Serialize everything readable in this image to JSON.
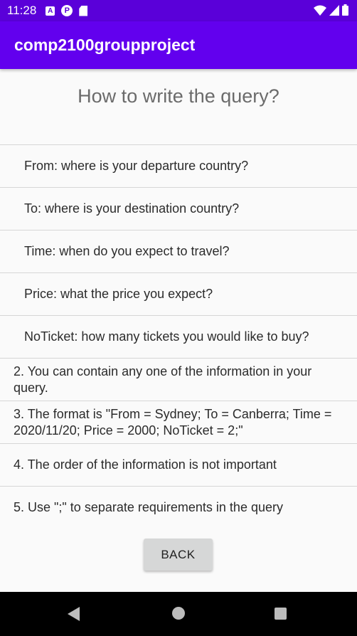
{
  "status_bar": {
    "time": "11:28",
    "icons": [
      "a-notification-icon",
      "p-notification-icon",
      "sd-card-icon",
      "wifi-icon",
      "cell-signal-icon",
      "battery-icon"
    ]
  },
  "app_bar": {
    "title": "comp2100groupproject"
  },
  "heading": "How to write the query?",
  "rows": [
    "From: where is your departure country?",
    "To: where is your destination country?",
    "Time: when do you expect to travel?",
    "Price: what the price you expect?",
    "NoTicket: how many tickets you would like to buy?",
    "2. You can contain any one of the information in your query.",
    "3. The format is \"From = Sydney; To = Canberra; Time = 2020/11/20; Price = 2000; NoTicket = 2;\"",
    "4. The order of the information is not important",
    "5. Use \";\" to separate requirements in the query"
  ],
  "back_button": "BACK",
  "colors": {
    "status_bar": "#5a00d9",
    "app_bar": "#6200ee",
    "background": "#fafafa",
    "button": "#d6d7d7"
  },
  "nav_bar": {
    "icons": [
      "back-icon",
      "home-icon",
      "recent-apps-icon"
    ]
  }
}
